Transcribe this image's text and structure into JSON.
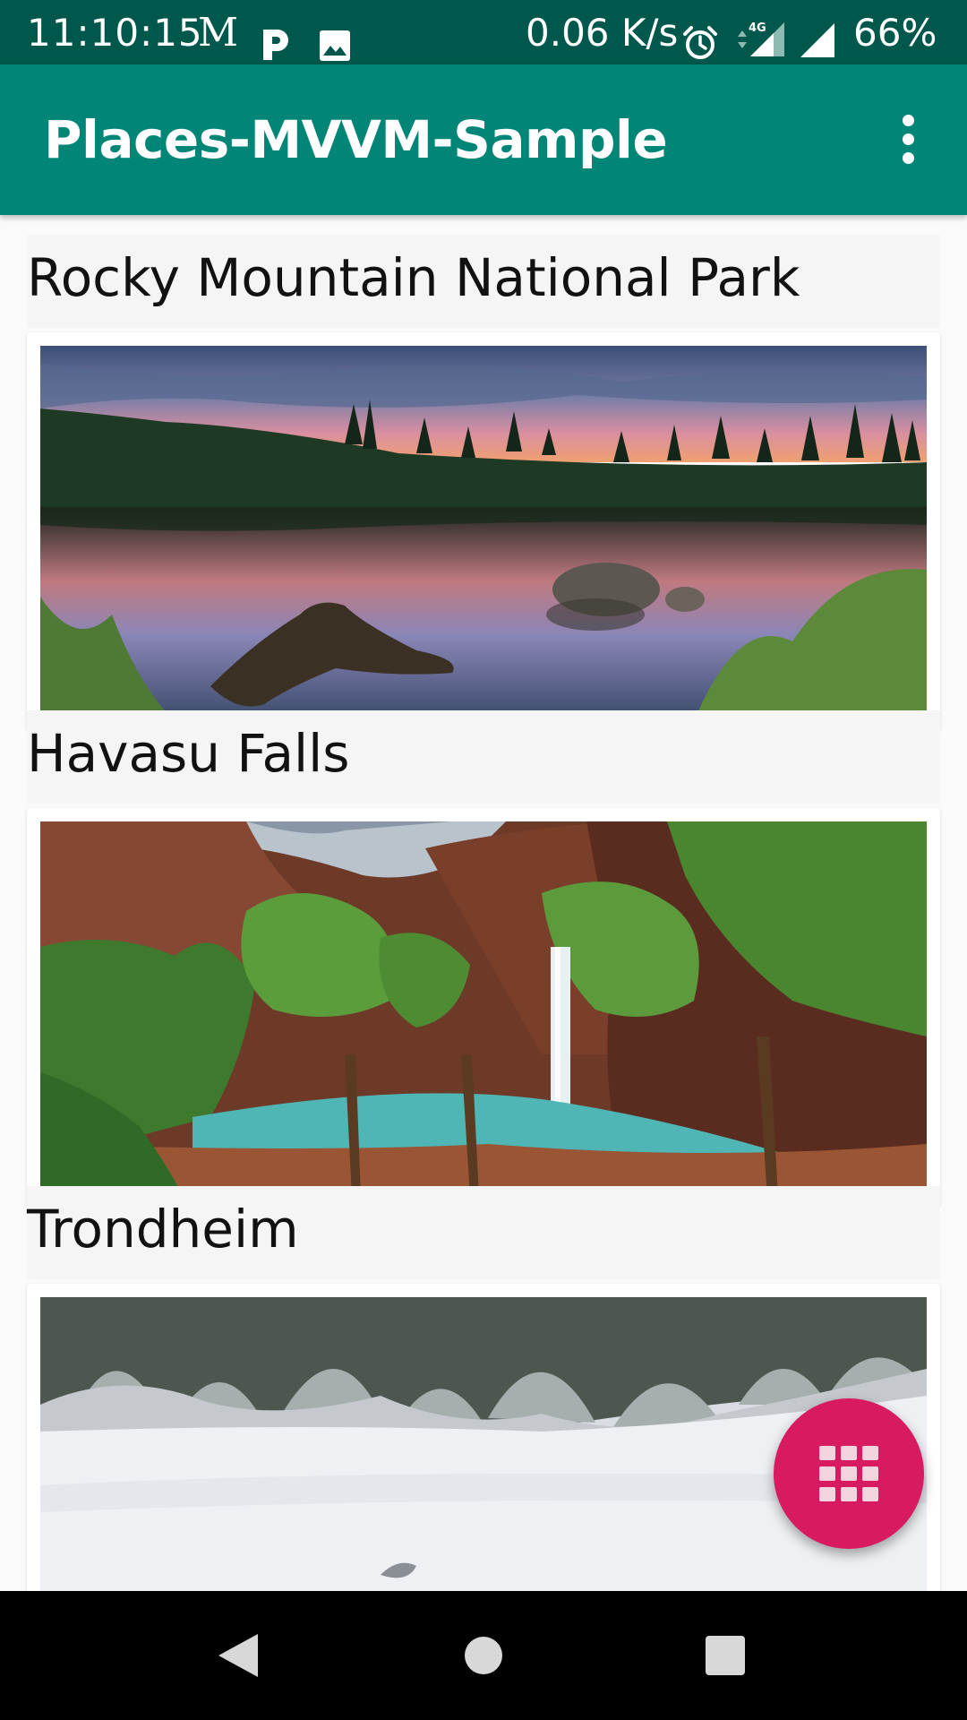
{
  "status_bar": {
    "time": "11:10:15",
    "gmail_letter": "M",
    "net_speed": "0.06 K/s",
    "network_type": "4G",
    "battery": "66%",
    "icons": [
      "gmail-icon",
      "parking-icon",
      "image-icon",
      "alarm-icon",
      "mobile-signal-icon",
      "wifi-signal-icon"
    ]
  },
  "app_bar": {
    "title": "Places-MVVM-Sample",
    "menu_icon": "more-vert-icon"
  },
  "places": [
    {
      "name": "Rocky Mountain National Park",
      "image": "alpine-lake-at-sunset"
    },
    {
      "name": "Havasu Falls",
      "image": "canyon-waterfall"
    },
    {
      "name": "Trondheim",
      "image": "snowy-forest"
    }
  ],
  "fab": {
    "icon": "grid-icon"
  },
  "nav_bar": {
    "icons": [
      "back-icon",
      "home-icon",
      "recents-icon"
    ]
  },
  "colors": {
    "status_bar": "#00574b",
    "primary": "#008577",
    "accent": "#d81b60",
    "background": "#fafafa"
  }
}
